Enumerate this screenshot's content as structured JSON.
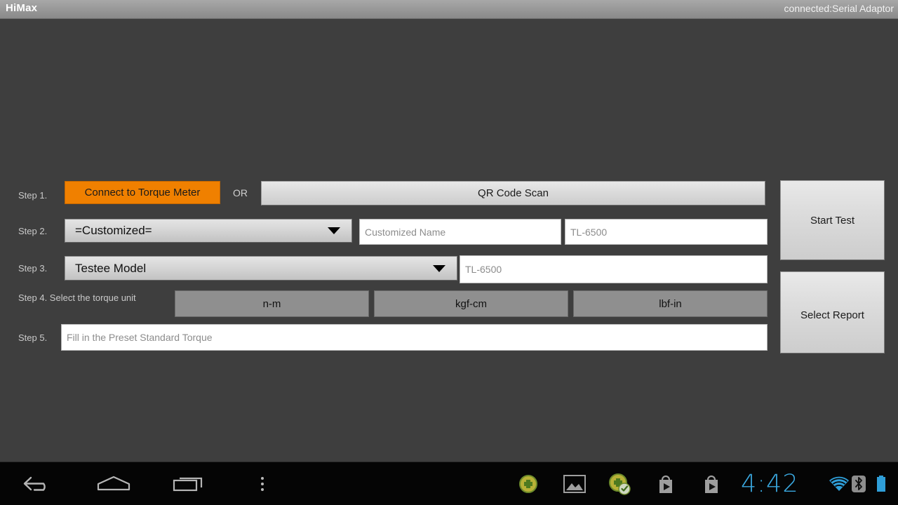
{
  "titlebar": {
    "app_name": "HiMax",
    "connection_status": "connected:Serial Adaptor"
  },
  "form": {
    "step1": {
      "label": "Step 1.",
      "connect_button": "Connect to Torque Meter",
      "or": "OR",
      "qr_button": "QR Code Scan"
    },
    "step2": {
      "label": "Step 2.",
      "spinner_value": "=Customized=",
      "name_placeholder": "Customized Name",
      "model_placeholder": "TL-6500"
    },
    "step3": {
      "label": "Step 3.",
      "spinner_value": "Testee Model",
      "model_placeholder": "TL-6500"
    },
    "step4": {
      "label": "Step 4. Select the torque unit",
      "units": [
        "n-m",
        "kgf-cm",
        "lbf-in"
      ]
    },
    "step5": {
      "label": "Step 5.",
      "torque_placeholder": "Fill in the Preset Standard Torque"
    }
  },
  "actions": {
    "start_test": "Start Test",
    "select_report": "Select Report"
  },
  "navbar": {
    "back": "back-icon",
    "home": "home-icon",
    "recents": "recents-icon",
    "menu": "overflow-menu-icon",
    "status_icons": [
      "sync-badge-icon",
      "gallery-icon",
      "sync-complete-icon",
      "play-store-icon",
      "play-store-icon"
    ],
    "clock": "4:42",
    "wifi": "wifi-icon",
    "bluetooth": "bluetooth-icon",
    "battery": "battery-icon"
  },
  "colors": {
    "background": "#3e3e3e",
    "accent_orange": "#f08000",
    "status_blue": "#3aa8e0",
    "unit_button": "#8f8f8f"
  }
}
